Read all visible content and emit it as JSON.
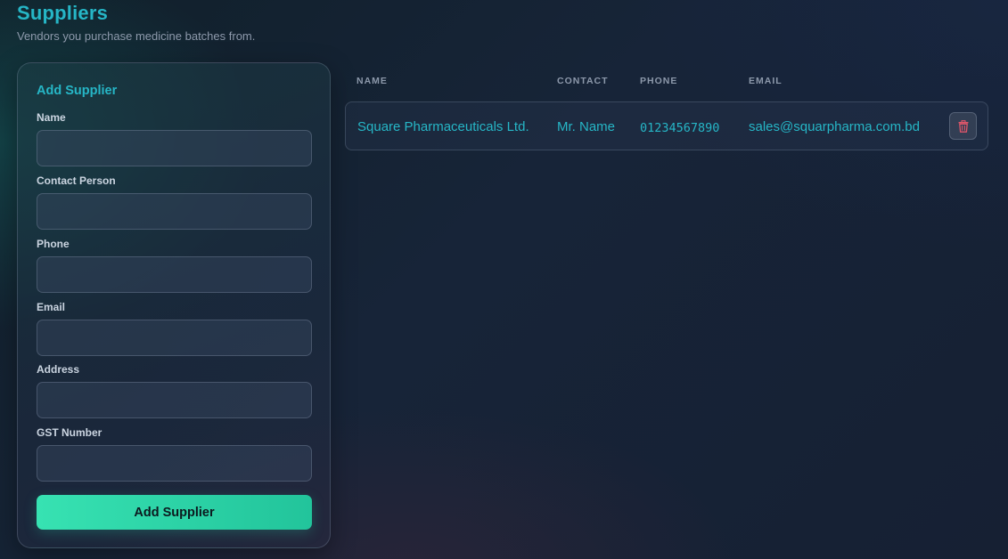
{
  "header": {
    "title": "Suppliers",
    "subtitle": "Vendors you purchase medicine batches from."
  },
  "form": {
    "title": "Add Supplier",
    "fields": [
      {
        "label": "Name",
        "value": ""
      },
      {
        "label": "Contact Person",
        "value": ""
      },
      {
        "label": "Phone",
        "value": ""
      },
      {
        "label": "Email",
        "value": ""
      },
      {
        "label": "Address",
        "value": ""
      },
      {
        "label": "GST Number",
        "value": ""
      }
    ],
    "submit_label": "Add Supplier"
  },
  "table": {
    "columns": [
      "NAME",
      "CONTACT",
      "PHONE",
      "EMAIL"
    ],
    "rows": [
      {
        "name": "Square Pharmaceuticals Ltd.",
        "contact": "Mr. Name",
        "phone": "01234567890",
        "email": "sales@squarpharma.com.bd",
        "action_icon": "trash-icon"
      }
    ]
  },
  "colors": {
    "accent": "#26b6c6",
    "button": "#2fd6aa",
    "danger": "#e0566a"
  }
}
